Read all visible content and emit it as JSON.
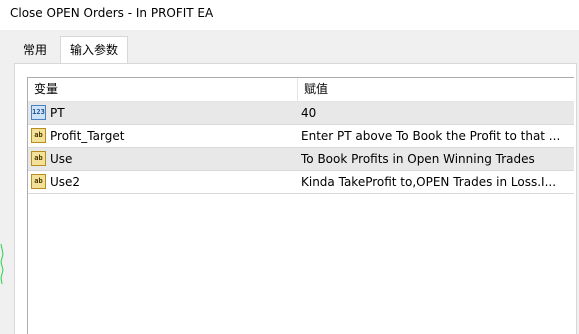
{
  "window": {
    "title": "Close OPEN Orders - In PROFIT EA"
  },
  "tabs": [
    {
      "label": "常用"
    },
    {
      "label": "输入参数"
    }
  ],
  "table": {
    "columns": [
      "变量",
      "赋值"
    ],
    "rows": [
      {
        "icon": "number-type-icon",
        "icon_text": "123",
        "name": "PT",
        "value": "40"
      },
      {
        "icon": "string-type-icon",
        "icon_text": "ab",
        "name": "Profit_Target",
        "value": "Enter PT above To Book the Profit to that ..."
      },
      {
        "icon": "string-type-icon",
        "icon_text": "ab",
        "name": "Use",
        "value": "To Book Profits in Open Winning Trades"
      },
      {
        "icon": "string-type-icon",
        "icon_text": "ab",
        "name": "Use2",
        "value": "Kinda TakeProfit to,OPEN Trades in Loss.I..."
      }
    ]
  }
}
